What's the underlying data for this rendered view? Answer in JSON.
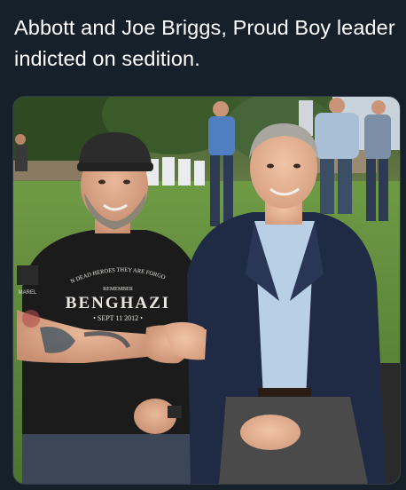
{
  "tweet": {
    "text": "Abbott and Joe Briggs, Proud Boy leader indicted on sedition."
  },
  "photo": {
    "shirt_print": {
      "arc_line": "WHEN DEAD HEROES THEY ARE FORGOTTEN",
      "small_line": "REMEMBER",
      "main_line": "BENGHAZI",
      "date_line": "• SEPT 11 2012 •"
    },
    "sleeve_patch": "MAREL"
  },
  "colors": {
    "background": "#15202b",
    "text": "#ffffff",
    "grass": "#5e8a3a",
    "blazer": "#1f2a44",
    "shirt_black": "#1b1b1b",
    "dress_shirt": "#b8cfe6"
  }
}
